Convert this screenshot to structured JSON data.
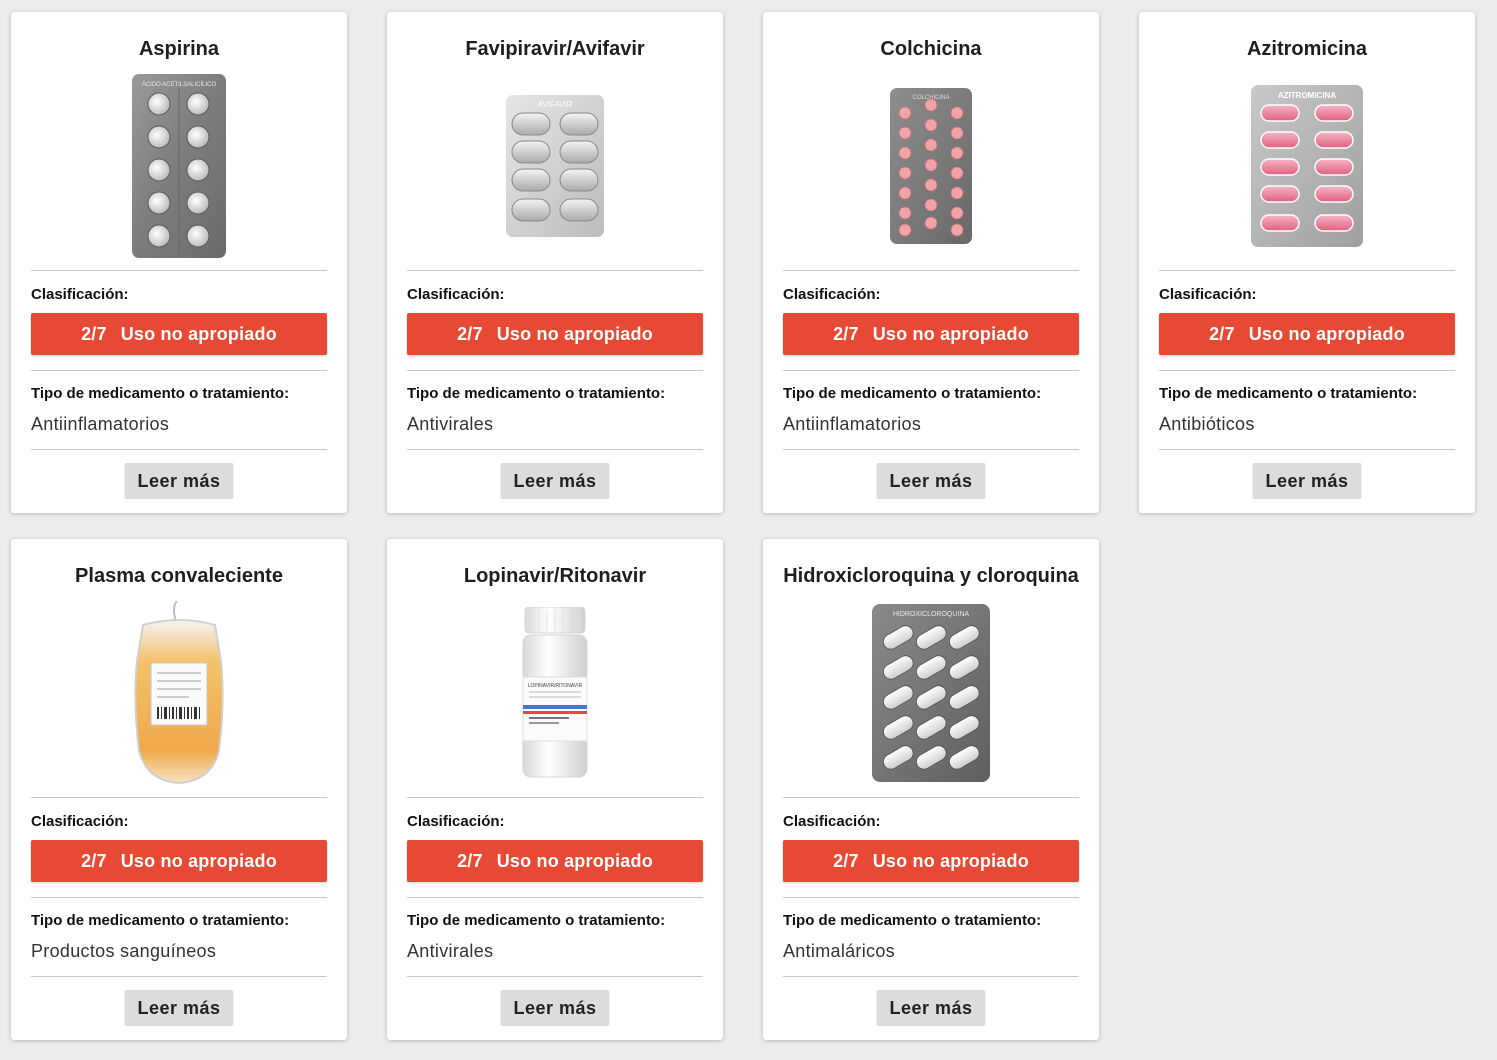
{
  "labels": {
    "classification": "Clasificación:",
    "type": "Tipo de medicamento o tratamiento:",
    "read_more": "Leer más"
  },
  "colors": {
    "background": "#ececec",
    "badge_red": "#e64a34",
    "button_gray": "#dcdcdc"
  },
  "cards": [
    {
      "title": "Aspirina",
      "image": "aspirin-blister-pack",
      "package_text": "ÁCIDO ACETILSALICÍLICO",
      "score": "2/7",
      "classification": "Uso no apropiado",
      "type": "Antiinflamatorios"
    },
    {
      "title": "Favipiravir/Avifavir",
      "image": "avifavir-blister-pack",
      "package_text": "AVIFAVIR",
      "score": "2/7",
      "classification": "Uso no apropiado",
      "type": "Antivirales"
    },
    {
      "title": "Colchicina",
      "image": "colchicine-blister-pack",
      "package_text": "COLCHICINA",
      "score": "2/7",
      "classification": "Uso no apropiado",
      "type": "Antiinflamatorios"
    },
    {
      "title": "Azitromicina",
      "image": "azithromycin-blister-pack",
      "package_text": "AZITROMICINA",
      "score": "2/7",
      "classification": "Uso no apropiado",
      "type": "Antibióticos"
    },
    {
      "title": "Plasma convaleciente",
      "image": "plasma-bag",
      "score": "2/7",
      "classification": "Uso no apropiado",
      "type": "Productos sanguíneos"
    },
    {
      "title": "Lopinavir/Ritonavir",
      "image": "medicine-bottle",
      "package_text": "LOPINAVIR/RITONAVIR",
      "score": "2/7",
      "classification": "Uso no apropiado",
      "type": "Antivirales"
    },
    {
      "title": "Hidroxicloroquina y cloroquina",
      "image": "hydroxychloroquine-blister-pack",
      "package_text": "HIDROXICLOROQUINA",
      "score": "2/7",
      "classification": "Uso no apropiado",
      "type": "Antimaláricos"
    }
  ]
}
